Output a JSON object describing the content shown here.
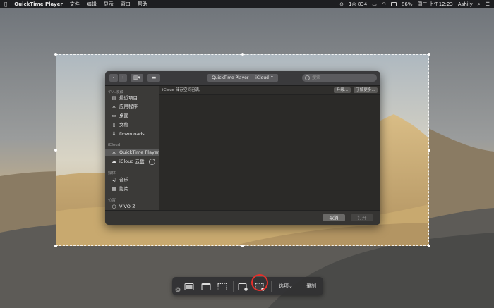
{
  "menubar": {
    "app_name": "QuickTime Player",
    "menus": [
      "文件",
      "编辑",
      "显示",
      "窗口",
      "帮助"
    ],
    "status_text": "1◎·834",
    "battery": "86%",
    "datetime": "周三 上午12:23",
    "user": "Ashily",
    "icons": [
      "apple-icon",
      "screen-record-icon",
      "wechat-icon",
      "airplay-icon",
      "wifi-icon",
      "battery-icon",
      "search-icon",
      "control-center-icon",
      "list-icon"
    ]
  },
  "dialog": {
    "path_popup": "QuickTime Player — iCloud",
    "search_placeholder": "搜索",
    "banner_text": "iCloud 储存空间已满。",
    "banner_upgrade": "升级...",
    "banner_learn": "了解更多...",
    "sidebar": {
      "sections": [
        {
          "title": "个人收藏",
          "items": [
            {
              "label": "最近项目",
              "icon": "recents-icon"
            },
            {
              "label": "应用程序",
              "icon": "applications-icon"
            },
            {
              "label": "桌面",
              "icon": "desktop-icon"
            },
            {
              "label": "文稿",
              "icon": "documents-icon"
            },
            {
              "label": "Downloads",
              "icon": "downloads-icon"
            }
          ]
        },
        {
          "title": "iCloud",
          "items": [
            {
              "label": "QuickTime Player",
              "icon": "quicktime-icon",
              "selected": true
            },
            {
              "label": "iCloud 云盘",
              "icon": "cloud-icon"
            }
          ]
        },
        {
          "title": "媒体",
          "items": [
            {
              "label": "音乐",
              "icon": "music-icon"
            },
            {
              "label": "影片",
              "icon": "movies-icon"
            }
          ]
        },
        {
          "title": "位置",
          "items": [
            {
              "label": "VIVO-Z",
              "icon": "disk-icon"
            }
          ]
        }
      ]
    },
    "cancel_label": "取消",
    "open_label": "打开"
  },
  "capture_toolbar": {
    "options_label": "选项",
    "record_label": "录制",
    "tools": [
      "close-icon",
      "capture-entire-screen-icon",
      "capture-window-icon",
      "capture-selection-icon",
      "record-entire-screen-icon",
      "record-selection-icon"
    ],
    "highlighted_tool": "record-selection-icon",
    "highlight_color": "#e5302b"
  }
}
